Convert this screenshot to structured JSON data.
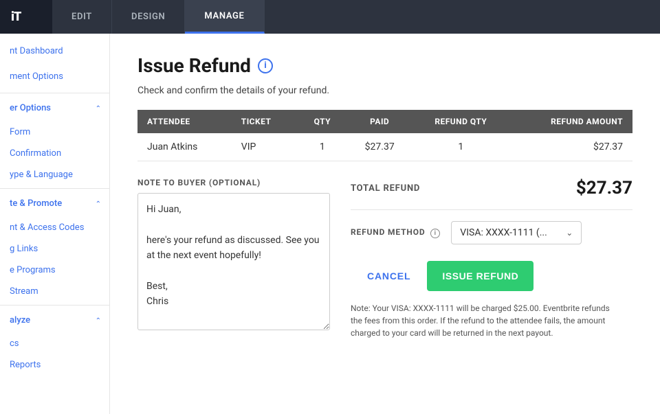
{
  "topNav": {
    "brand": "iT",
    "items": [
      {
        "label": "EDIT",
        "active": false
      },
      {
        "label": "DESIGN",
        "active": false
      },
      {
        "label": "MANAGE",
        "active": true
      }
    ]
  },
  "sidebar": {
    "items": [
      {
        "label": "nt Dashboard",
        "type": "link"
      },
      {
        "label": "ment Options",
        "type": "link"
      },
      {
        "label": "er Options",
        "type": "section",
        "expanded": true
      },
      {
        "label": "Form",
        "type": "sub"
      },
      {
        "label": "Confirmation",
        "type": "sub"
      },
      {
        "label": "ype & Language",
        "type": "sub"
      },
      {
        "label": "te & Promote",
        "type": "section",
        "expanded": true
      },
      {
        "label": "nt & Access Codes",
        "type": "sub"
      },
      {
        "label": "g Links",
        "type": "sub"
      },
      {
        "label": "e Programs",
        "type": "sub"
      },
      {
        "label": "Stream",
        "type": "sub"
      },
      {
        "label": "alyze",
        "type": "section",
        "expanded": true
      },
      {
        "label": "cs",
        "type": "sub"
      },
      {
        "label": "Reports",
        "type": "sub"
      }
    ]
  },
  "page": {
    "title": "Issue Refund",
    "subtitle": "Check and confirm the details of your refund.",
    "table": {
      "headers": [
        "ATTENDEE",
        "TICKET",
        "QTY",
        "PAID",
        "REFUND QTY",
        "REFUND AMOUNT"
      ],
      "rows": [
        {
          "attendee": "Juan Atkins",
          "ticket": "VIP",
          "qty": "1",
          "paid": "$27.37",
          "refundQty": "1",
          "refundAmount": "$27.37"
        }
      ]
    },
    "noteLabel": "NOTE TO BUYER (OPTIONAL)",
    "noteText": "Hi Juan,\n\nhere's your refund as discussed. See you at the next event hopefully!\n\nBest,\nChris",
    "totalRefundLabel": "TOTAL REFUND",
    "totalRefundAmount": "$27.37",
    "refundMethodLabel": "REFUND METHOD",
    "refundMethodValue": "VISA: XXXX-1111 (...",
    "cancelLabel": "CANCEL",
    "issueRefundLabel": "ISSUE REFUND",
    "noteFooter": "Note: Your VISA: XXXX-1111 will be charged $25.00. Eventbrite refunds the fees from this order. If the refund to the attendee fails, the amount charged to your card will be returned in the next payout."
  }
}
